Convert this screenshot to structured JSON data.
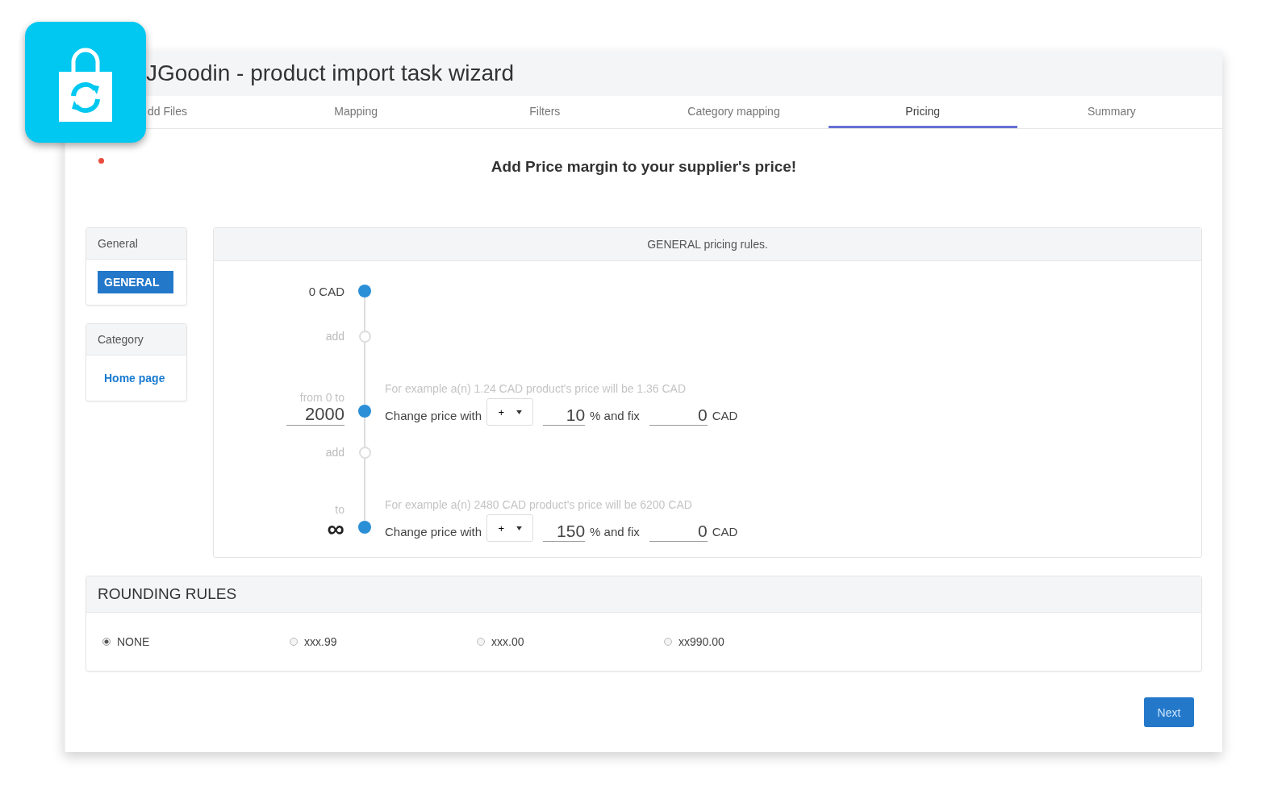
{
  "window": {
    "title": "JGoodin - product import task wizard"
  },
  "tabs": [
    {
      "label": "dd Files",
      "selected": false
    },
    {
      "label": "Mapping",
      "selected": false
    },
    {
      "label": "Filters",
      "selected": false
    },
    {
      "label": "Category mapping",
      "selected": false
    },
    {
      "label": "Pricing",
      "selected": true
    },
    {
      "label": "Summary",
      "selected": false
    }
  ],
  "heading": "Add Price margin to your supplier's price!",
  "sidebar": [
    {
      "title": "General",
      "items": [
        {
          "label": "GENERAL",
          "selected": true
        }
      ]
    },
    {
      "title": "Category",
      "items": [
        {
          "label": "Home page",
          "selected": false
        }
      ]
    }
  ],
  "rules": {
    "title": "GENERAL pricing rules.",
    "timeline": [
      {
        "kind": "start",
        "label": "0 CAD"
      },
      {
        "kind": "add",
        "label": "add"
      },
      {
        "kind": "tier",
        "caption": "from 0 to",
        "limit_field": "2000",
        "example": "For example a(n) 1.24 CAD product's price will be 1.36 CAD",
        "change_label": "Change price with",
        "operator": "+",
        "percent": "10",
        "percent_label": "% and fix",
        "fix": "0",
        "currency": "CAD"
      },
      {
        "kind": "add",
        "label": "add"
      },
      {
        "kind": "tier",
        "caption": "to",
        "limit_symbol": "∞",
        "example": "For example a(n) 2480 CAD product's price will be 6200 CAD",
        "change_label": "Change price with",
        "operator": "+",
        "percent": "150",
        "percent_label": "% and fix",
        "fix": "0",
        "currency": "CAD"
      }
    ]
  },
  "rounding": {
    "title": "ROUNDING RULES",
    "options": [
      {
        "label": "NONE",
        "selected": true
      },
      {
        "label": "xxx.99",
        "selected": false
      },
      {
        "label": "xxx.00",
        "selected": false
      },
      {
        "label": "xx990.00",
        "selected": false
      }
    ]
  },
  "next_button": "Next"
}
